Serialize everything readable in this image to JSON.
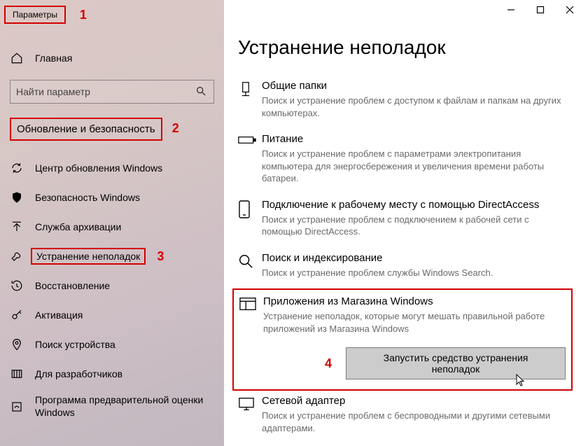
{
  "app": {
    "title": "Параметры"
  },
  "annotations": {
    "one": "1",
    "two": "2",
    "three": "3",
    "four": "4"
  },
  "sidebar": {
    "home_label": "Главная",
    "search_placeholder": "Найти параметр",
    "section_header": "Обновление и безопасность",
    "items": [
      {
        "label": "Центр обновления Windows"
      },
      {
        "label": "Безопасность Windows"
      },
      {
        "label": "Служба архивации"
      },
      {
        "label": "Устранение неполадок"
      },
      {
        "label": "Восстановление"
      },
      {
        "label": "Активация"
      },
      {
        "label": "Поиск устройства"
      },
      {
        "label": "Для разработчиков"
      },
      {
        "label": "Программа предварительной оценки Windows"
      }
    ]
  },
  "main": {
    "title": "Устранение неполадок",
    "items": [
      {
        "title": "Общие папки",
        "desc": "Поиск и устранение проблем с доступом к файлам и папкам на других компьютерах."
      },
      {
        "title": "Питание",
        "desc": "Поиск и устранение проблем с параметрами электропитания компьютера для энергосбережения и увеличения  времени работы батареи."
      },
      {
        "title": "Подключение к рабочему месту с помощью DirectAccess",
        "desc": "Поиск и устранение проблем с подключением к рабочей сети с помощью DirectAccess."
      },
      {
        "title": "Поиск и индексирование",
        "desc": "Поиск и устранение проблем службы Windows Search."
      },
      {
        "title": "Приложения из Магазина Windows",
        "desc": "Устранение неполадок, которые могут мешать правильной работе приложений из Магазина Windows"
      },
      {
        "title": "Сетевой адаптер",
        "desc": "Поиск и устранение проблем с беспроводными и другими сетевыми адаптерами."
      }
    ],
    "run_button": "Запустить средство устранения неполадок"
  }
}
